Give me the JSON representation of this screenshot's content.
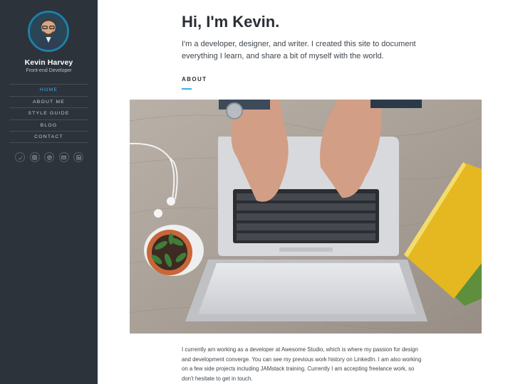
{
  "profile": {
    "name": "Kevin Harvey",
    "role": "Front-end Developer"
  },
  "nav": {
    "items": [
      {
        "label": "HOME",
        "active": true
      },
      {
        "label": "ABOUT ME",
        "active": false
      },
      {
        "label": "STYLE GUIDE",
        "active": false
      },
      {
        "label": "BLOG",
        "active": false
      },
      {
        "label": "CONTACT",
        "active": false
      }
    ]
  },
  "social": [
    "twitter-icon",
    "instagram-icon",
    "dribbble-icon",
    "email-icon",
    "linkedin-icon"
  ],
  "main": {
    "title": "Hi, I'm Kevin.",
    "intro": "I'm a developer, designer, and writer. I created this site to document everything I learn, and share a bit of myself with the world.",
    "section_label": "ABOUT",
    "body": "I currently am working as a developer at Awesome Studio, which is where my passion for design and development converge. You can see my previous work history on LinkedIn. I am also working on a few side projects including JAMstack training. Currently I am accepting freelance work, so don't hesitate to get in touch."
  },
  "colors": {
    "sidebar_bg": "#2c333b",
    "accent": "#3ab0e2",
    "text_dark": "#2a2f36"
  }
}
